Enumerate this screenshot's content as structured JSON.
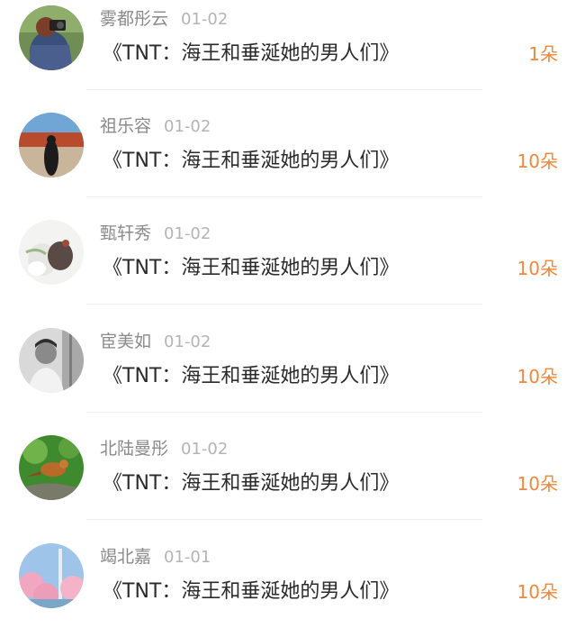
{
  "items": [
    {
      "name": "雾都彤云",
      "date": "01-02",
      "title": "《TNT：海王和垂涎她的男人们》",
      "count": "1朵"
    },
    {
      "name": "祖乐容",
      "date": "01-02",
      "title": "《TNT：海王和垂涎她的男人们》",
      "count": "10朵"
    },
    {
      "name": "甄轩秀",
      "date": "01-02",
      "title": "《TNT：海王和垂涎她的男人们》",
      "count": "10朵"
    },
    {
      "name": "宦美如",
      "date": "01-02",
      "title": "《TNT：海王和垂涎她的男人们》",
      "count": "10朵"
    },
    {
      "name": "北陆曼彤",
      "date": "01-02",
      "title": "《TNT：海王和垂涎她的男人们》",
      "count": "10朵"
    },
    {
      "name": "竭北嘉",
      "date": "01-01",
      "title": "《TNT：海王和垂涎她的男人们》",
      "count": "10朵"
    }
  ],
  "colors": {
    "count_accent": "#f0873a",
    "name_text": "#8a8a8a",
    "date_text": "#b4b4b4",
    "title_text": "#2b2b2b"
  }
}
